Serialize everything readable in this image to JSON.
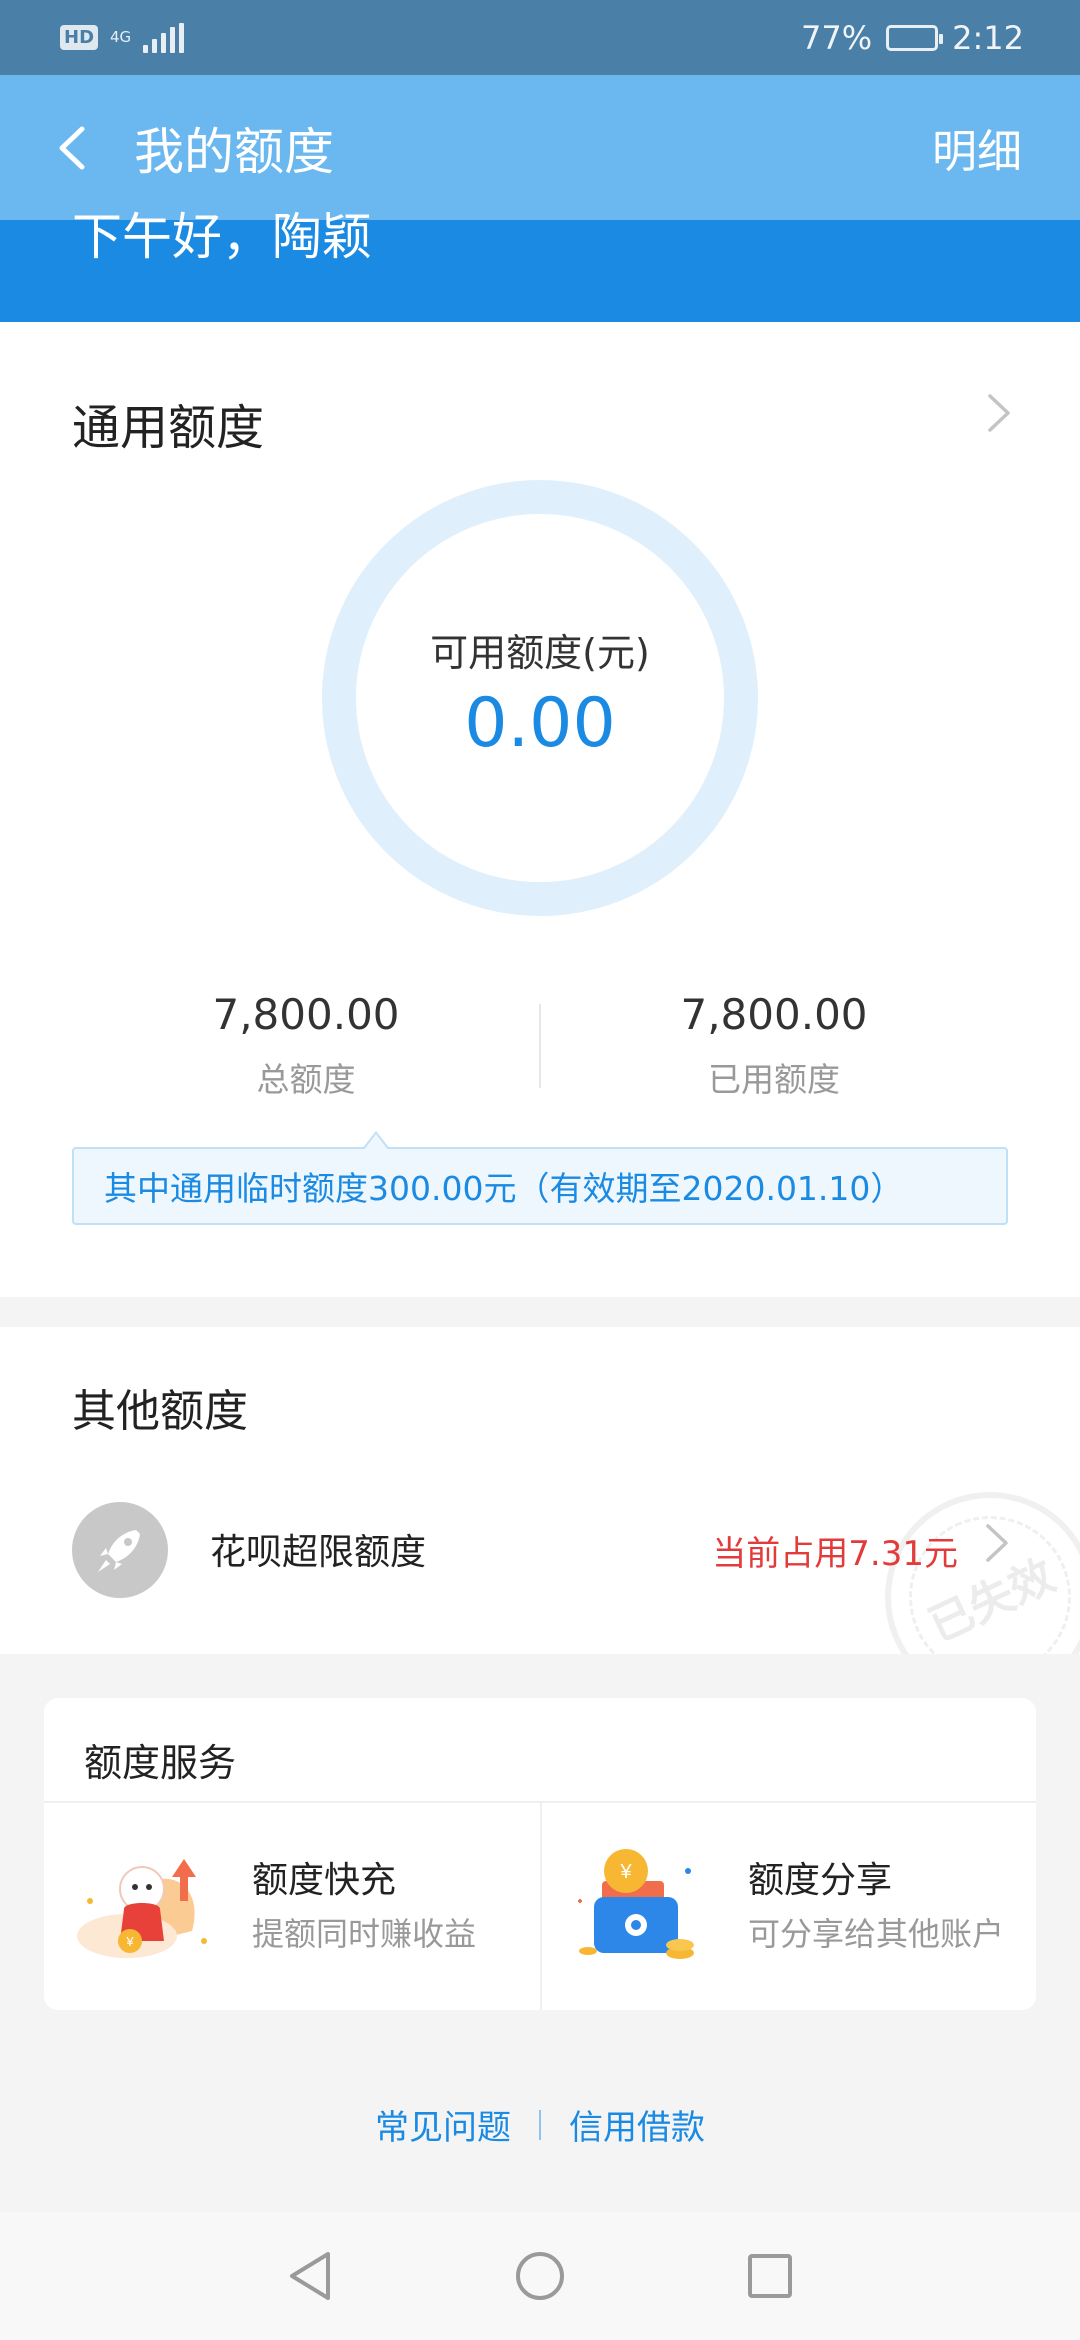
{
  "status_bar": {
    "hd": "HD",
    "network": "4G",
    "battery_percent": "77%",
    "battery_level": 0.77,
    "time": "2:12"
  },
  "header": {
    "title": "我的额度",
    "detail_label": "明细",
    "greeting": "下午好，陶颖",
    "back_icon": "back-arrow-icon",
    "bg_color": "#1a8ae3",
    "nav_color": "#6ab8ef"
  },
  "general_limit": {
    "title": "通用额度",
    "available_label": "可用额度(元)",
    "available_value": "0.00",
    "total_value": "7,800.00",
    "total_label": "总额度",
    "used_value": "7,800.00",
    "used_label": "已用额度",
    "tip": "其中通用临时额度300.00元（有效期至2020.01.10）"
  },
  "other_limits": {
    "title": "其他额度",
    "items": [
      {
        "label": "花呗超限额度",
        "value": "当前占用7.31元",
        "icon": "rocket-icon"
      }
    ],
    "stamp_text": "已失效"
  },
  "services": {
    "title": "额度服务",
    "items": [
      {
        "name": "额度快充",
        "desc": "提额同时赚收益",
        "icon": "mascot-coin-icon"
      },
      {
        "name": "额度分享",
        "desc": "可分享给其他账户",
        "icon": "wallet-coin-icon"
      }
    ]
  },
  "footer": {
    "links": [
      "常见问题",
      "信用借款"
    ]
  },
  "colors": {
    "accent": "#1a8ae3",
    "warning": "#e23b3b"
  }
}
